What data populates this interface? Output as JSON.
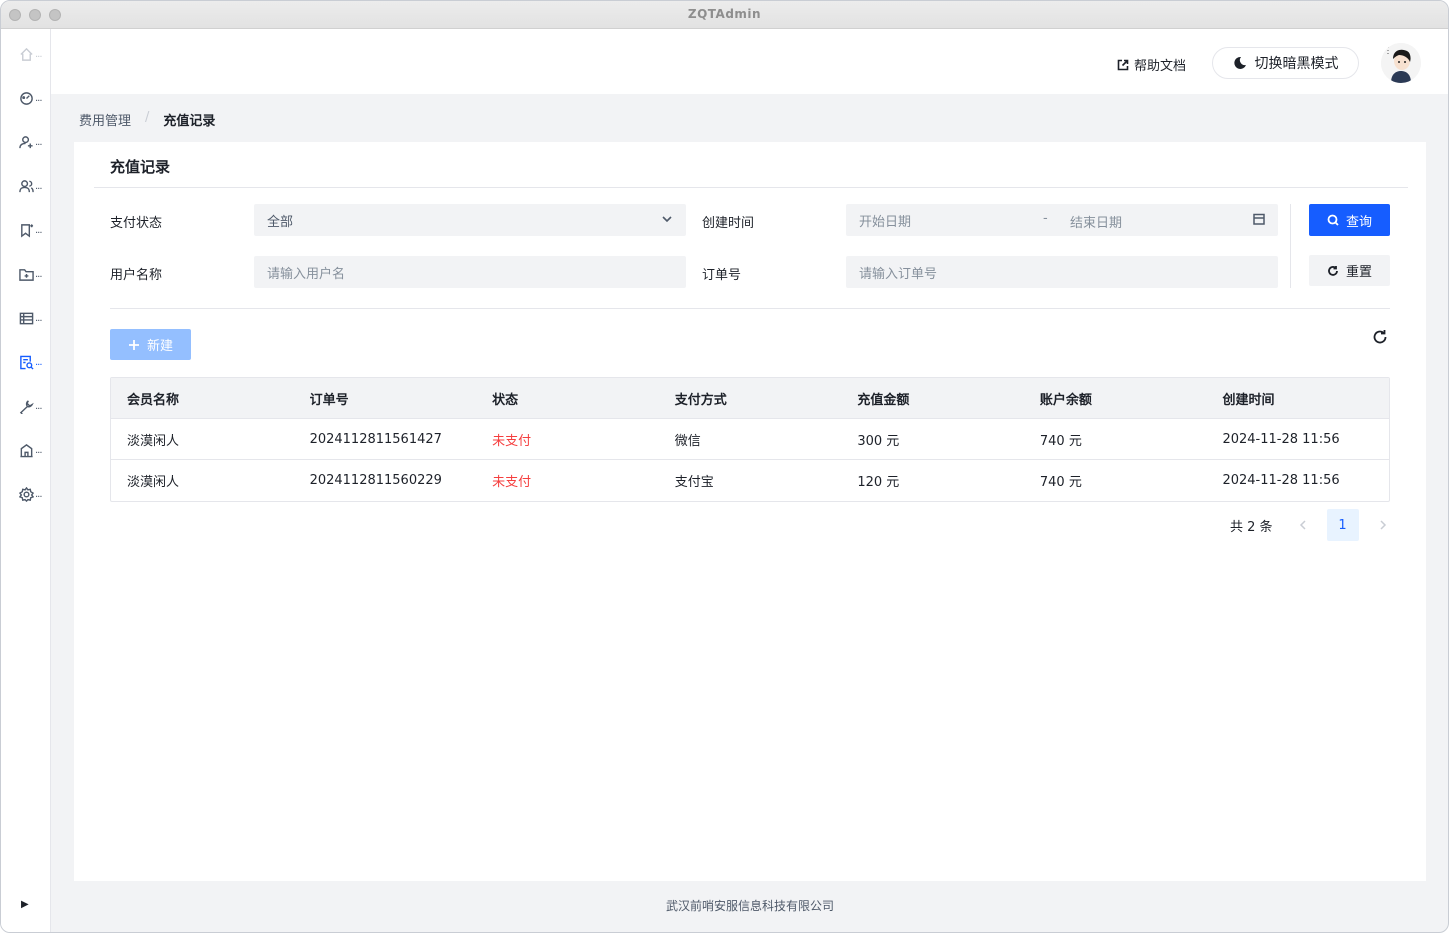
{
  "window": {
    "title": "ZQTAdmin"
  },
  "sidebar": {
    "items": [
      {
        "icon": "home-icon",
        "label": "..."
      },
      {
        "icon": "dashboard-icon",
        "label": "..."
      },
      {
        "icon": "user-add-icon",
        "label": "..."
      },
      {
        "icon": "users-icon",
        "label": "..."
      },
      {
        "icon": "bookmark-icon",
        "label": "..."
      },
      {
        "icon": "folder-add-icon",
        "label": "..."
      },
      {
        "icon": "table-icon",
        "label": "..."
      },
      {
        "icon": "file-search-icon",
        "label": "..."
      },
      {
        "icon": "tool-icon",
        "label": "..."
      },
      {
        "icon": "building-icon",
        "label": "..."
      },
      {
        "icon": "settings-icon",
        "label": "..."
      }
    ],
    "active_icon": "file-search-icon"
  },
  "header": {
    "help_label": "帮助文档",
    "theme_label": "切换暗黑模式"
  },
  "breadcrumb": {
    "parent": "费用管理",
    "separator": "/",
    "current": "充值记录"
  },
  "card": {
    "title": "充值记录"
  },
  "filters": {
    "pay_status_label": "支付状态",
    "pay_status_value": "全部",
    "created_time_label": "创建时间",
    "start_date_placeholder": "开始日期",
    "range_separator": "-",
    "end_date_placeholder": "结束日期",
    "username_label": "用户名称",
    "username_placeholder": "请输入用户名",
    "order_no_label": "订单号",
    "order_no_placeholder": "请输入订单号",
    "search_label": "查询",
    "reset_label": "重置"
  },
  "toolbar": {
    "new_label": "新建"
  },
  "table": {
    "columns": [
      "会员名称",
      "订单号",
      "状态",
      "支付方式",
      "充值金额",
      "账户余额",
      "创建时间"
    ],
    "rows": [
      [
        "淡漠闲人",
        "2024112811561427",
        "未支付",
        "微信",
        "300 元",
        "740 元",
        "2024-11-28 11:56"
      ],
      [
        "淡漠闲人",
        "2024112811560229",
        "未支付",
        "支付宝",
        "120 元",
        "740 元",
        "2024-11-28 11:56"
      ]
    ]
  },
  "pagination": {
    "total_label": "共 2 条",
    "current_page": "1"
  },
  "footer": {
    "company": "武汉前哨安服信息科技有限公司"
  },
  "colors": {
    "primary": "#165dff",
    "danger": "#f53f3f",
    "primary_disabled": "#94bfff"
  }
}
